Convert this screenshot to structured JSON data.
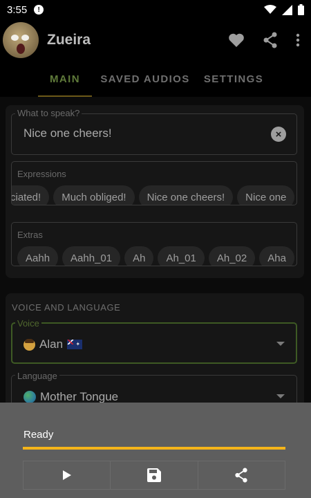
{
  "status_bar": {
    "time": "3:55",
    "notification_badge": "!"
  },
  "app_bar": {
    "title": "Zueira"
  },
  "tabs": [
    {
      "label": "MAIN",
      "active": true
    },
    {
      "label": "SAVED AUDIOS",
      "active": false
    },
    {
      "label": "SETTINGS",
      "active": false
    }
  ],
  "speak": {
    "label": "What to speak?",
    "value": "Nice one cheers!"
  },
  "expressions": {
    "title": "Expressions",
    "chips": [
      "ciated!",
      "Much obliged!",
      "Nice one cheers!",
      "Nice one"
    ]
  },
  "extras": {
    "title": "Extras",
    "chips": [
      "Aahh",
      "Aahh_01",
      "Ah",
      "Ah_01",
      "Ah_02",
      "Aha"
    ]
  },
  "voice_section": {
    "title": "VOICE AND LANGUAGE",
    "voice_label": "Voice",
    "voice_value": "Alan",
    "language_label": "Language",
    "language_value": "Mother Tongue"
  },
  "player": {
    "status": "Ready",
    "progress": 1.0
  },
  "colors": {
    "accent_progress": "#f5b419",
    "active_tab": "#5f7a3a",
    "voice_border": "#3e5a24",
    "sheet_bg": "#5e5e5e"
  }
}
